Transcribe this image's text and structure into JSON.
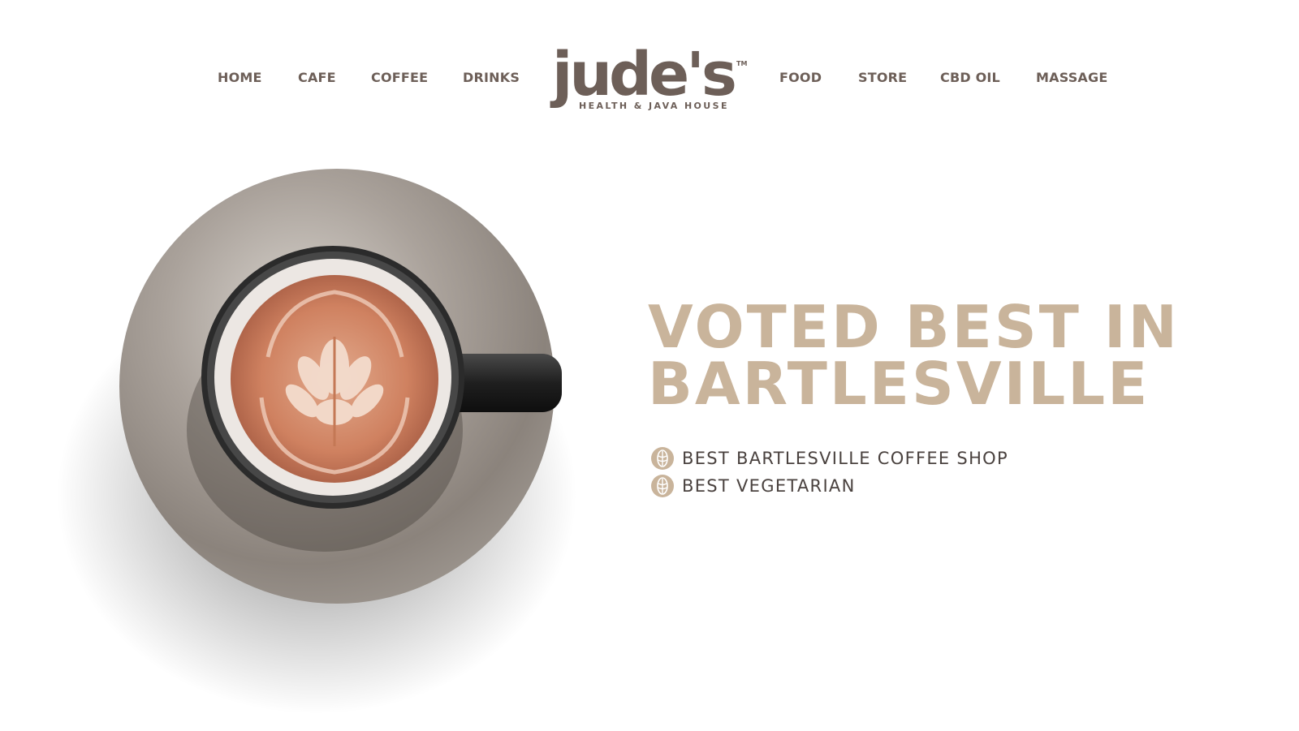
{
  "nav": {
    "left": [
      {
        "label": "HOME"
      },
      {
        "label": "CAFE"
      },
      {
        "label": "COFFEE"
      },
      {
        "label": "DRINKS"
      }
    ],
    "right": [
      {
        "label": "FOOD"
      },
      {
        "label": "STORE"
      },
      {
        "label": "CBD OIL"
      },
      {
        "label": "MASSAGE"
      }
    ]
  },
  "logo": {
    "name": "jude's",
    "trademark": "TM",
    "tagline": "HEALTH & JAVA HOUSE"
  },
  "hero": {
    "headline": [
      "VOTED BEST IN",
      "BARTLESVILLE"
    ],
    "awards": [
      {
        "label": "BEST BARTLESVILLE COFFEE SHOP",
        "icon": "latte-art-badge-icon"
      },
      {
        "label": "BEST VEGETARIAN",
        "icon": "latte-art-badge-icon"
      }
    ],
    "image": "latte-cup-on-saucer"
  },
  "colors": {
    "brand_brown": "#6d5f58",
    "headline_tan": "#c9b49b",
    "body_text": "#4a423f",
    "background": "#ffffff"
  }
}
